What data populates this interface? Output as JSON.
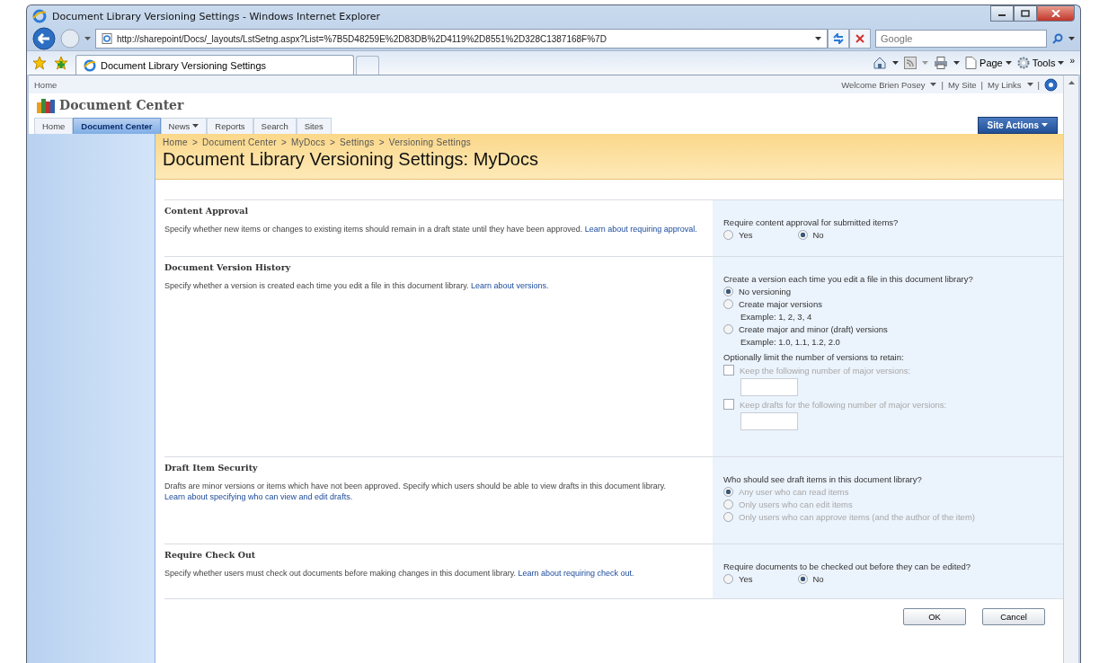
{
  "window": {
    "title": "Document Library Versioning Settings - Windows Internet Explorer"
  },
  "address_bar": {
    "url": "http://sharepoint/Docs/_layouts/LstSetng.aspx?List=%7B5D48259E%2D83DB%2D4119%2D8551%2D328C1387168F%7D"
  },
  "search": {
    "placeholder": "Google"
  },
  "browser_tabs": [
    {
      "label": "Document Library Versioning Settings",
      "selected": true
    }
  ],
  "command_bar": [
    {
      "label": "Page",
      "kind": "page"
    },
    {
      "label": "Tools",
      "kind": "tools"
    }
  ],
  "command_more": "»",
  "top_bar": {
    "breadcrumb": "Home",
    "user_menu": [
      {
        "label": "Welcome Brien Posey",
        "dropdown": true
      },
      {
        "label": "My Site",
        "dropdown": false
      },
      {
        "label": "My Links",
        "dropdown": true
      }
    ],
    "separator": "|"
  },
  "site": {
    "title": "Document Center"
  },
  "nav": [
    {
      "label": "Home",
      "selected": false,
      "dropdown": false
    },
    {
      "label": "Document Center",
      "selected": true,
      "dropdown": false
    },
    {
      "label": "News",
      "selected": false,
      "dropdown": true
    },
    {
      "label": "Reports",
      "selected": false,
      "dropdown": false
    },
    {
      "label": "Search",
      "selected": false,
      "dropdown": false
    },
    {
      "label": "Sites",
      "selected": false,
      "dropdown": false
    }
  ],
  "site_actions": {
    "label": "Site Actions",
    "dropdown": true
  },
  "page_header": {
    "breadcrumb": [
      "Home",
      "Document Center",
      "MyDocs",
      "Settings",
      "Versioning Settings"
    ],
    "separator": ">",
    "title": "Document Library Versioning Settings: MyDocs"
  },
  "sections": [
    {
      "title": "Content Approval",
      "description": "Specify whether new items or changes to existing items should remain in a draft state until they have been approved.",
      "link": "Learn about requiring approval.",
      "controls": [
        {
          "kind": "prompt",
          "text": "Require content approval for submitted items?"
        },
        {
          "kind": "radio_row",
          "options": [
            {
              "label": "Yes",
              "selected": false,
              "disabled": false
            },
            {
              "label": "No",
              "selected": true,
              "disabled": false
            }
          ]
        }
      ]
    },
    {
      "title": "Document Version History",
      "description": "Specify whether a version is created each time you edit a file in this document library.",
      "link": "Learn about versions.",
      "controls": [
        {
          "kind": "prompt",
          "text": "Create a version each time you edit a file in this document library?"
        },
        {
          "kind": "radio",
          "label": "No versioning",
          "selected": true,
          "disabled": false
        },
        {
          "kind": "radio",
          "label": "Create major versions",
          "selected": false,
          "disabled": false
        },
        {
          "kind": "example",
          "text": "Example: 1, 2, 3, 4"
        },
        {
          "kind": "radio",
          "label": "Create major and minor (draft) versions",
          "selected": false,
          "disabled": false
        },
        {
          "kind": "example",
          "text": "Example: 1.0, 1.1, 1.2, 2.0"
        },
        {
          "kind": "prompt",
          "text": "Optionally limit the number of versions to retain:"
        },
        {
          "kind": "checkbox",
          "label": "Keep the following number of major versions:",
          "checked": false,
          "disabled": true
        },
        {
          "kind": "field",
          "disabled": true
        },
        {
          "kind": "checkbox",
          "label": "Keep drafts for the following number of major versions:",
          "checked": false,
          "disabled": true
        },
        {
          "kind": "field",
          "disabled": true
        }
      ]
    },
    {
      "title": "Draft Item Security",
      "description": "Drafts are minor versions or items which have not been approved. Specify which users should be able to view drafts in this document library.",
      "link": "Learn about specifying who can view and edit drafts.",
      "controls": [
        {
          "kind": "prompt",
          "text": "Who should see draft items in this document library?"
        },
        {
          "kind": "radio",
          "label": "Any user who can read items",
          "selected": true,
          "disabled": true
        },
        {
          "kind": "radio",
          "label": "Only users who can edit items",
          "selected": false,
          "disabled": true
        },
        {
          "kind": "radio",
          "label": "Only users who can approve items (and the author of the item)",
          "selected": false,
          "disabled": true
        }
      ]
    },
    {
      "title": "Require Check Out",
      "description": "Specify whether users must check out documents before making changes in this document library.",
      "link": "Learn about requiring check out.",
      "controls": [
        {
          "kind": "prompt",
          "text": "Require documents to be checked out before they can be edited?"
        },
        {
          "kind": "radio_row",
          "options": [
            {
              "label": "Yes",
              "selected": false,
              "disabled": false
            },
            {
              "label": "No",
              "selected": true,
              "disabled": false
            }
          ]
        }
      ]
    }
  ],
  "buttons": [
    {
      "label": "OK"
    },
    {
      "label": "Cancel"
    }
  ]
}
